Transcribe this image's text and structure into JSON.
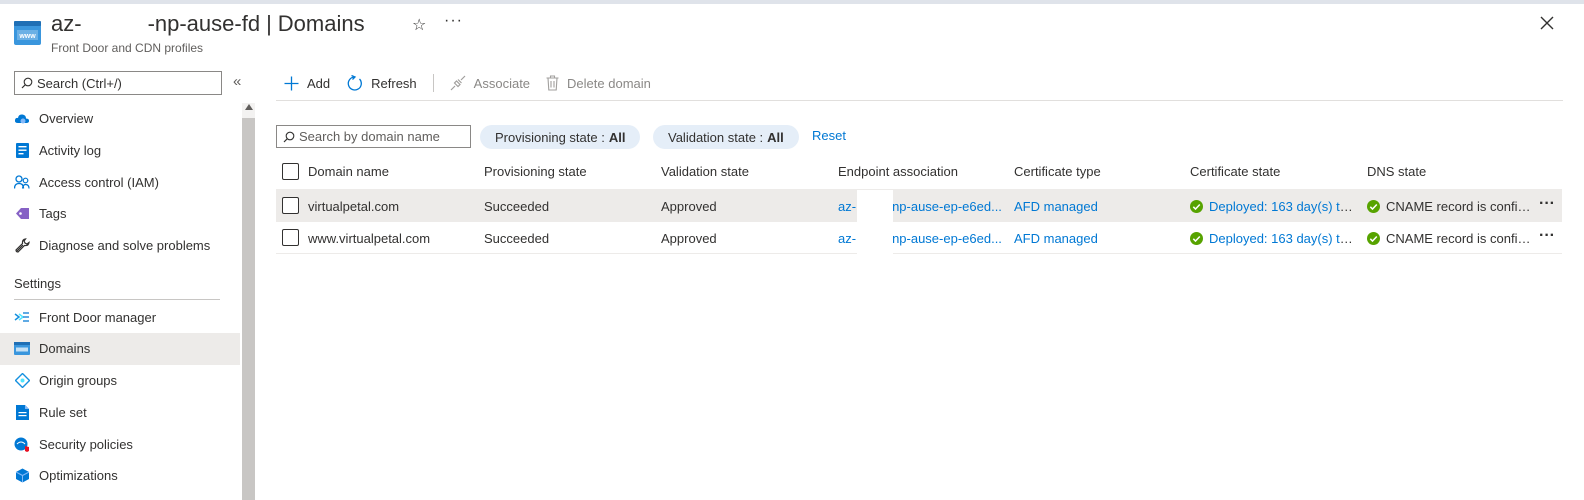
{
  "header": {
    "title_prefix": "az-",
    "title_suffix": "-np-ause-fd",
    "title_separator": "|",
    "title_page": "Domains",
    "subtitle": "Front Door and CDN profiles"
  },
  "nav": {
    "search_placeholder": "Search (Ctrl+/)",
    "items": [
      {
        "label": "Overview",
        "icon": "cloud-icon"
      },
      {
        "label": "Activity log",
        "icon": "activity-log-icon"
      },
      {
        "label": "Access control (IAM)",
        "icon": "people-icon"
      },
      {
        "label": "Tags",
        "icon": "tag-icon"
      },
      {
        "label": "Diagnose and solve problems",
        "icon": "wrench-icon"
      }
    ],
    "section_label": "Settings",
    "settings_items": [
      {
        "label": "Front Door manager",
        "icon": "front-door-icon"
      },
      {
        "label": "Domains",
        "icon": "domains-icon",
        "active": true
      },
      {
        "label": "Origin groups",
        "icon": "origin-groups-icon"
      },
      {
        "label": "Rule set",
        "icon": "rule-set-icon"
      },
      {
        "label": "Security policies",
        "icon": "security-policies-icon"
      },
      {
        "label": "Optimizations",
        "icon": "optimizations-icon"
      }
    ]
  },
  "toolbar": {
    "add_label": "Add",
    "refresh_label": "Refresh",
    "associate_label": "Associate",
    "delete_label": "Delete domain"
  },
  "filters": {
    "search_placeholder": "Search by domain name",
    "provisioning_label": "Provisioning state :",
    "provisioning_value": "All",
    "validation_label": "Validation state :",
    "validation_value": "All",
    "reset_label": "Reset"
  },
  "table": {
    "columns": [
      "Domain name",
      "Provisioning state",
      "Validation state",
      "Endpoint association",
      "Certificate type",
      "Certificate state",
      "DNS state"
    ],
    "rows": [
      {
        "domain": "virtualpetal.com",
        "provisioning": "Succeeded",
        "validation": "Approved",
        "endpoint_prefix": "az-",
        "endpoint_suffix": "np-ause-ep-e6ed...",
        "cert_type": "AFD managed",
        "cert_state": "Deployed: 163 day(s) to ...",
        "dns_state": "CNAME record is config..."
      },
      {
        "domain": "www.virtualpetal.com",
        "provisioning": "Succeeded",
        "validation": "Approved",
        "endpoint_prefix": "az-",
        "endpoint_suffix": "np-ause-ep-e6ed...",
        "cert_type": "AFD managed",
        "cert_state": "Deployed: 163 day(s) to ...",
        "dns_state": "CNAME record is config..."
      }
    ]
  },
  "colors": {
    "accent": "#0078d4",
    "success": "#57a300",
    "pill_bg": "#e5eef8",
    "active_nav_bg": "#edebe9"
  }
}
